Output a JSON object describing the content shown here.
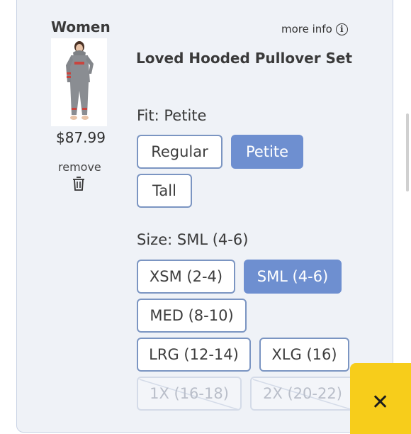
{
  "item": {
    "category": "Women",
    "price": "$87.99",
    "remove_label": "remove",
    "more_info_label": "more info",
    "name": "Loved Hooded Pullover Set"
  },
  "fit": {
    "label": "Fit:",
    "selected": "Petite",
    "options": [
      "Regular",
      "Petite",
      "Tall"
    ]
  },
  "size": {
    "label": "Size:",
    "selected": "SML (4-6)",
    "options": [
      "XSM (2-4)",
      "SML (4-6)",
      "MED (8-10)",
      "LRG (12-14)",
      "XLG (16)",
      "1X (16-18)",
      "2X (20-22)"
    ]
  },
  "colors": {
    "accent": "#6e8fd0",
    "button_border": "#7b95c2",
    "card_bg": "#eff2f7",
    "close_bg": "#f7cd1b"
  },
  "icons": {
    "info": "info-icon",
    "trash": "trash-icon",
    "close": "close-icon"
  },
  "close_glyph": "✕"
}
